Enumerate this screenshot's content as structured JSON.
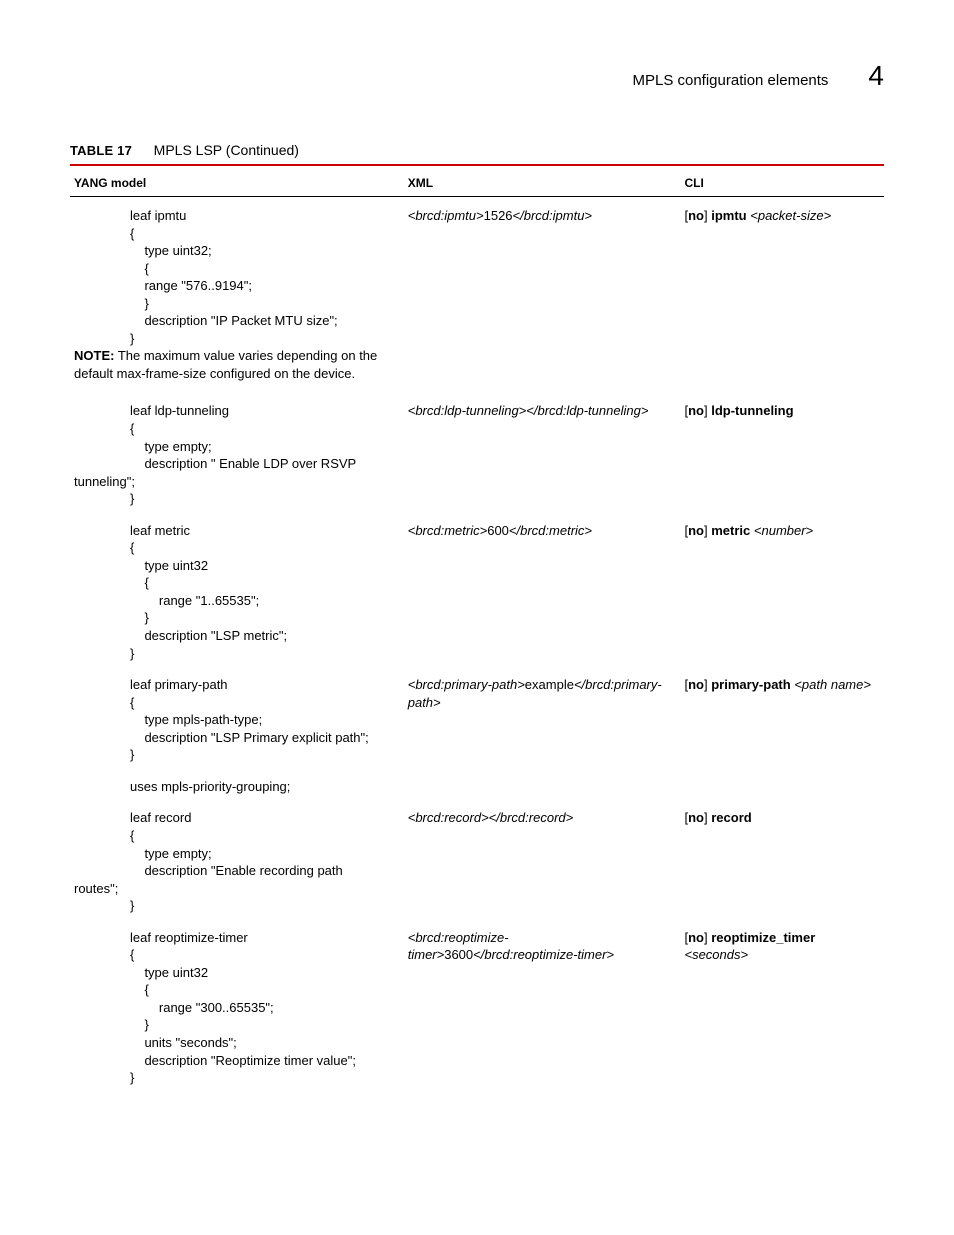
{
  "header": {
    "title": "MPLS configuration elements",
    "chapter": "4"
  },
  "tableCaption": {
    "num": "TABLE 17",
    "title": "MPLS LSP  (Continued)"
  },
  "columns": {
    "yang": "YANG model",
    "xml": "XML",
    "cli": "CLI"
  },
  "rows": {
    "ipmtu": {
      "yang": "leaf ipmtu\n{\n    type uint32;\n    {\n    range \"576..9194\";\n    }\n    description \"IP Packet MTU size\";\n}",
      "note_label": "NOTE:",
      "note_text": "The maximum value varies depending on the default max-frame-size configured on the device.",
      "xml_pre": "<brcd:ipmtu>",
      "xml_val": "1526",
      "xml_post": "</brcd:ipmtu>",
      "cli_no": "no",
      "cli_cmd": "ipmtu",
      "cli_arg": "<packet-size>"
    },
    "ldp": {
      "yang_pre": "leaf ldp-tunneling\n{\n    type empty;\n    description \" Enable LDP over RSVP",
      "yang_out": "tunneling\";",
      "yang_post": "}",
      "xml_pre": "<brcd:ldp-tunneling>",
      "xml_post": "</brcd:ldp-tunneling>",
      "cli_no": "no",
      "cli_cmd": "ldp-tunneling"
    },
    "metric": {
      "yang": "leaf metric\n{\n    type uint32\n    {\n        range \"1..65535\";\n    }\n    description \"LSP metric\";\n}",
      "xml_pre": "<brcd:metric>",
      "xml_val": "600",
      "xml_post": "</brcd:metric>",
      "cli_no": "no",
      "cli_cmd": "metric",
      "cli_arg": "<number>"
    },
    "primary": {
      "yang": "leaf primary-path\n{\n    type mpls-path-type;\n    description \"LSP Primary explicit path\";\n}",
      "xml_pre": "<brcd:primary-path>",
      "xml_val": "example",
      "xml_post": "</brcd:primary-path>",
      "cli_no": "no",
      "cli_cmd": "primary-path",
      "cli_arg": "<path name>"
    },
    "uses": {
      "yang": "uses mpls-priority-grouping;"
    },
    "record": {
      "yang_pre": "leaf record\n{\n    type empty;\n    description \"Enable recording path",
      "yang_out": "routes\";",
      "yang_post": "}",
      "xml_pre": "<brcd:record>",
      "xml_post": "</brcd:record>",
      "cli_no": "no",
      "cli_cmd": "record"
    },
    "reopt": {
      "yang": "leaf reoptimize-timer\n{\n    type uint32\n    {\n        range \"300..65535\";\n    }\n    units \"seconds\";\n    description \"Reoptimize timer value\";\n}",
      "xml_pre": "<brcd:reoptimize-timer>",
      "xml_val": "3600",
      "xml_post": "</brcd:reoptimize-timer>",
      "cli_no": "no",
      "cli_cmd": "reoptimize_timer",
      "cli_arg": "<seconds>"
    }
  }
}
